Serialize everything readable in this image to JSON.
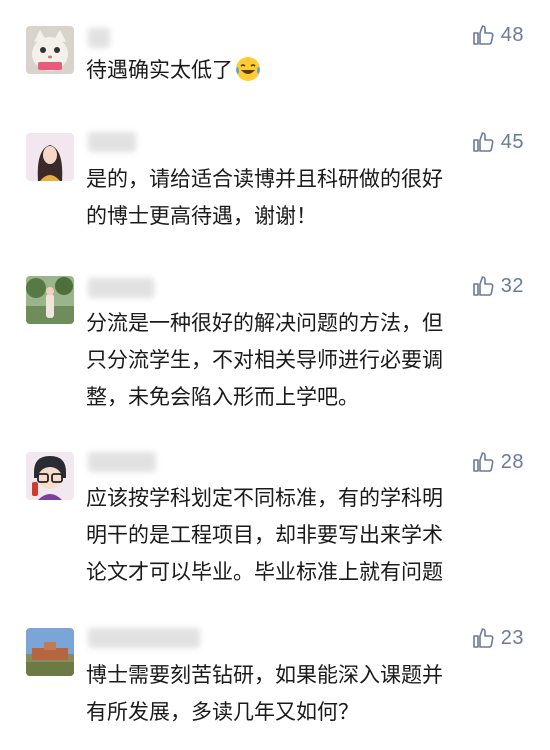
{
  "comments": [
    {
      "likes": "48",
      "text": "待遇确实太低了",
      "emoji": "laughing-crying-emoji"
    },
    {
      "likes": "45",
      "text": "是的，请给适合读博并且科研做的很好\n的博士更高待遇，谢谢！"
    },
    {
      "likes": "32",
      "text": "分流是一种很好的解决问题的方法，但\n只分流学生，不对相关导师进行必要调\n整，未免会陷入形而上学吧。"
    },
    {
      "likes": "28",
      "text": "应该按学科划定不同标准，有的学科明\n明干的是工程项目，却非要写出来学术\n论文才可以毕业。毕业标准上就有问题"
    },
    {
      "likes": "23",
      "text": "博士需要刻苦钻研，如果能深入课题并\n有所发展，多读几年又如何？"
    }
  ],
  "icons": {
    "like": "thumbs-up-icon"
  },
  "colors": {
    "like": "#6b7a99",
    "text": "#1a1a1a"
  }
}
